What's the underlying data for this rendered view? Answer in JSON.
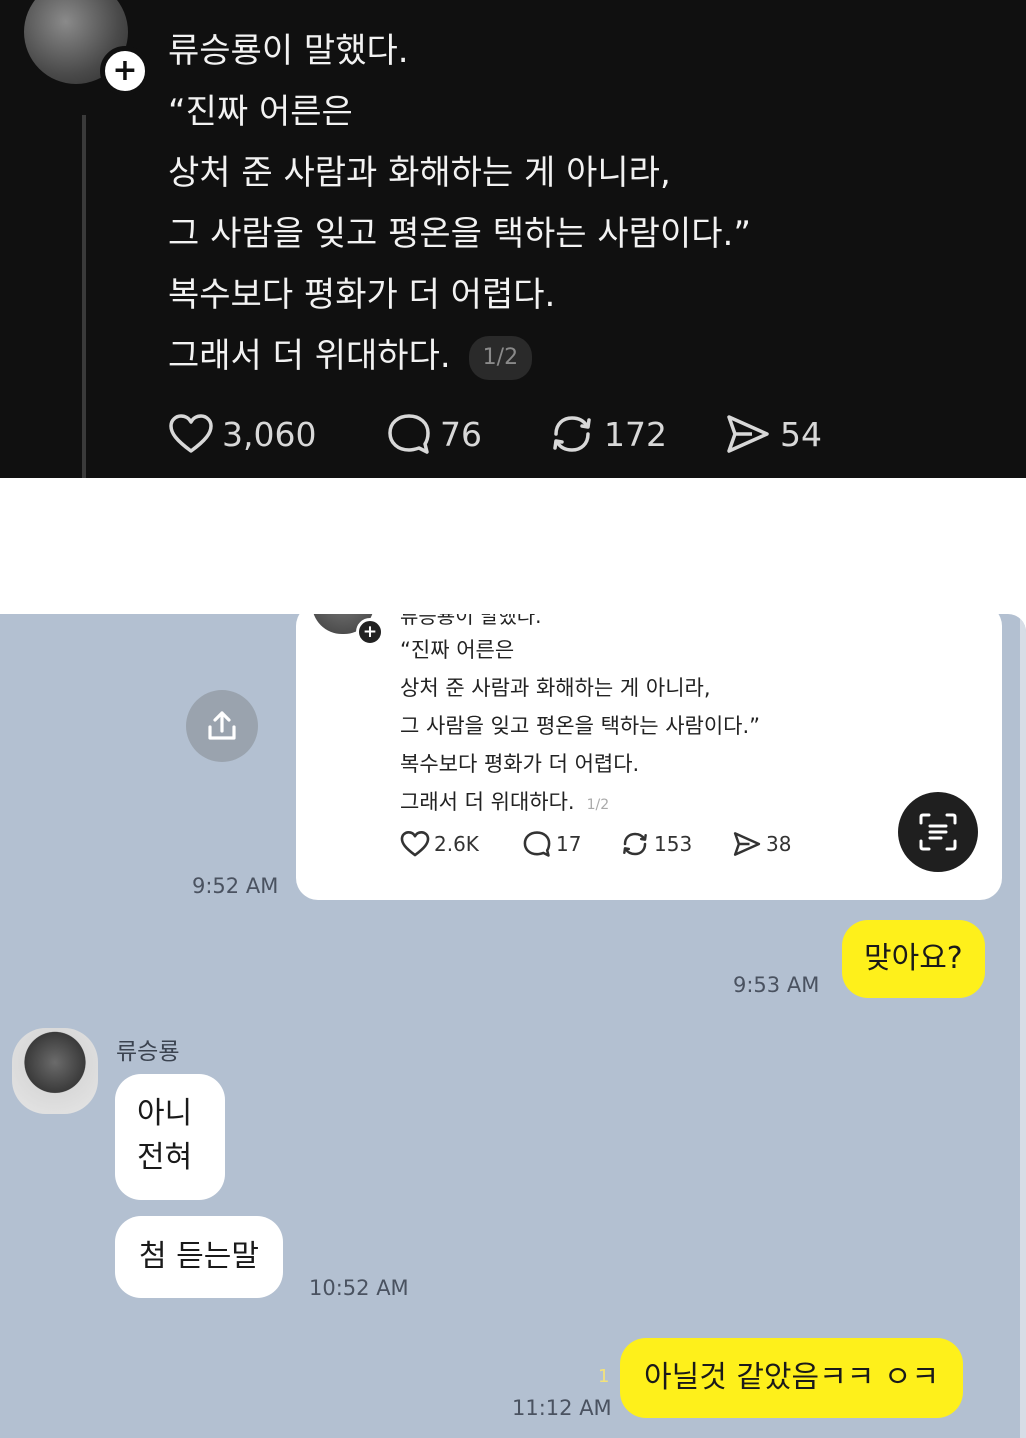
{
  "top_post": {
    "username": "",
    "lines": [
      "류승룡이 말했다.",
      "“진짜 어른은",
      "상처 준 사람과 화해하는 게 아니라,",
      "그 사람을 잊고 평온을 택하는 사람이다.”",
      "복수보다 평화가 더 어렵다.",
      "그래서 더 위대하다."
    ],
    "pager": "1/2",
    "likes": "3,060",
    "comments": "76",
    "reposts": "172",
    "shares": "54"
  },
  "chat": {
    "shared_card": {
      "username": "류승룡이 말했다.",
      "lines": [
        "“진짜 어른은",
        "상처 준 사람과 화해하는 게 아니라,",
        "그 사람을 잊고 평온을 택하는 사람이다.”",
        "복수보다 평화가 더 어렵다.",
        "그래서 더 위대하다."
      ],
      "pager": "1/2",
      "likes": "2.6K",
      "comments": "17",
      "reposts": "153",
      "shares": "38",
      "time": "9:52 AM"
    },
    "messages": {
      "me_1": {
        "text": "맞아요?",
        "time": "9:53 AM"
      },
      "friend_name": "류승룡",
      "friend_1": {
        "line1": "아니",
        "line2": "전혀"
      },
      "friend_2": {
        "text": "첨 듣는말",
        "time": "10:52 AM"
      },
      "me_2": {
        "text": "아닐것 같았음ㅋㅋ ㅇㅋ",
        "time": "11:12 AM",
        "unread": "1"
      }
    }
  },
  "colors": {
    "dark_bg": "#101010",
    "chat_bg": "#b3c0d1",
    "my_bubble": "#fef01b",
    "their_bubble": "#ffffff"
  }
}
